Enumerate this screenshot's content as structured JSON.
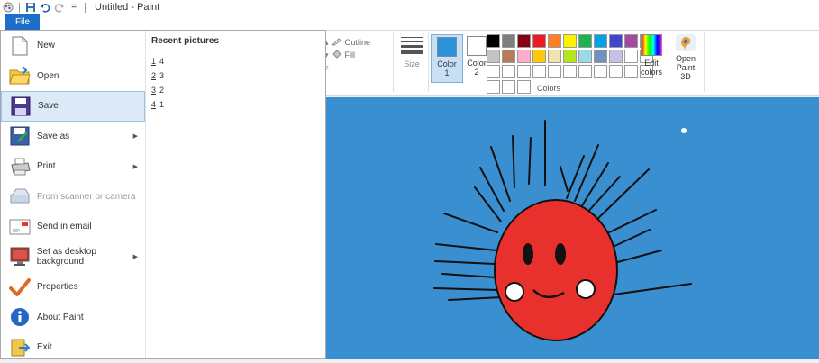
{
  "window": {
    "title": "Untitled - Paint"
  },
  "quick_access": {
    "save_icon": "save-icon",
    "undo_icon": "undo-icon",
    "redo_icon": "redo-icon",
    "customize_icon": "customize-quick-access-icon",
    "customize_glyph": "="
  },
  "ribbon": {
    "file_tab": "File",
    "shapes": {
      "outline_label": "Outline",
      "fill_label": "Fill"
    },
    "size_label": "Size",
    "color1_label": "Color\n1",
    "color2_label": "Color\n2",
    "colors_group_label": "Colors",
    "edit_colors_label": "Edit\ncolors",
    "paint3d_label": "Open\nPaint 3D",
    "color1_value": "#2b93d9",
    "color2_value": "#ffffff",
    "palette": [
      "#000000",
      "#7f7f7f",
      "#880015",
      "#ed1c24",
      "#ff7f27",
      "#fff200",
      "#22b14c",
      "#00a2e8",
      "#3f48cc",
      "#a349a4",
      "#ffffff",
      "#c3c3c3",
      "#b97a57",
      "#ffaec9",
      "#ffc90e",
      "#efe4b0",
      "#b5e61d",
      "#99d9ea",
      "#7092be",
      "#c8bfe7",
      "",
      "",
      "",
      "",
      "",
      "",
      "",
      "",
      "",
      "",
      "",
      "",
      "",
      "",
      "",
      ""
    ]
  },
  "file_menu": {
    "items": [
      {
        "label": "New",
        "icon": "new-file-icon"
      },
      {
        "label": "Open",
        "icon": "open-folder-icon"
      },
      {
        "label": "Save",
        "icon": "save-icon"
      },
      {
        "label": "Save as",
        "icon": "save-as-icon"
      },
      {
        "label": "Print",
        "icon": "printer-icon"
      },
      {
        "label": "From scanner or camera",
        "icon": "scanner-icon"
      },
      {
        "label": "Send in email",
        "icon": "email-icon"
      },
      {
        "label": "Set as desktop background",
        "icon": "desktop-background-icon"
      },
      {
        "label": "Properties",
        "icon": "properties-checkmark-icon"
      },
      {
        "label": "About Paint",
        "icon": "info-icon"
      },
      {
        "label": "Exit",
        "icon": "exit-icon"
      }
    ],
    "recent_title": "Recent pictures",
    "recent": [
      {
        "num": "1",
        "name": "4"
      },
      {
        "num": "2",
        "name": "3"
      },
      {
        "num": "3",
        "name": "2"
      },
      {
        "num": "4",
        "name": "1"
      }
    ]
  },
  "colors": {
    "canvas_bg": "#3a8fd0",
    "sun": "#e8302c",
    "file_blue": "#1c6ec8"
  }
}
